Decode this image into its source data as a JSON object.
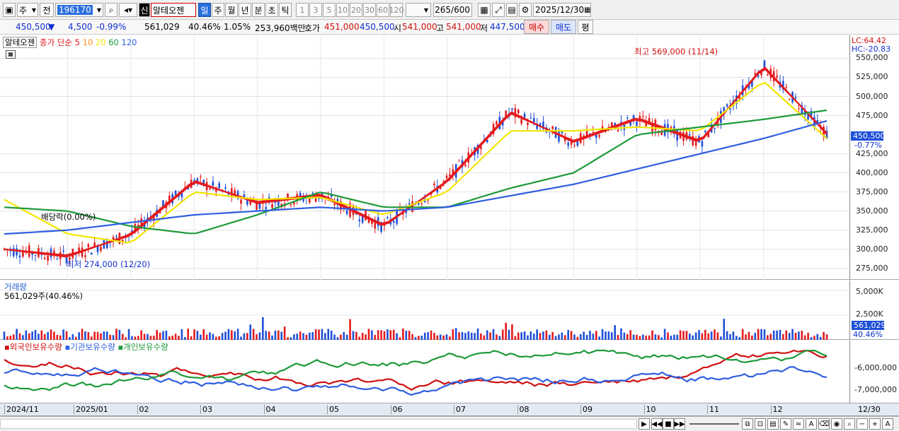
{
  "toolbar": {
    "market_label": "주",
    "market_arrow": "▼",
    "scope_label": "전",
    "code": "196170",
    "company_badge": "신",
    "company_name": "알테오젠",
    "periods": [
      "일",
      "주",
      "월",
      "년",
      "분",
      "초",
      "틱"
    ],
    "selected_period": "일",
    "intervals": [
      "1",
      "3",
      "5",
      "10",
      "20",
      "30",
      "60",
      "120"
    ],
    "count": "265",
    "count_total": "/600",
    "date": "2025/12/30"
  },
  "quote": {
    "price": "450,500",
    "change": "4,500",
    "change_arrow": "▼",
    "change_pct": "-0.99%",
    "volume": "561,029",
    "turnover_pct": "40.46%",
    "ratio": "1.05%",
    "amount": "253,960백만",
    "bid_label": "호가",
    "bid": "451,000",
    "ask": "450,500",
    "open_label": "시",
    "open": "541,000",
    "high_label": "고",
    "high": "541,000",
    "low_label": "저",
    "low": "447,500",
    "buy_label": "매수",
    "sell_label": "매도",
    "eval_label": "평"
  },
  "price_pane": {
    "title": "알테오젠",
    "legend_close": "종가",
    "legend_type": "단순",
    "ma": [
      {
        "period": "5",
        "color": "#e41a1c"
      },
      {
        "period": "10",
        "color": "#ff8c1a"
      },
      {
        "period": "20",
        "color": "#f2e600"
      },
      {
        "period": "60",
        "color": "#1f9a3a"
      },
      {
        "period": "120",
        "color": "#2f5fe0"
      }
    ],
    "lc": "LC:64.42",
    "hc": "HC:-20.83",
    "current_tag": "450,500",
    "current_pct": "-0.77%",
    "high_note": "최고 569,000 (11/14)",
    "low_note": "최저 274,000 (12/20)",
    "div_note": "배당락(0.00%)",
    "y_ticks": [
      "550,000",
      "525,000",
      "500,000",
      "475,000",
      "425,000",
      "400,000",
      "375,000",
      "350,000",
      "325,000",
      "300,000",
      "275,000"
    ]
  },
  "volume_pane": {
    "title": "거래량",
    "value": "561,029주(40.46%)",
    "y_ticks": [
      "5,000K",
      "2,500K"
    ],
    "tag": "561,029",
    "tag_pct": "40.46%"
  },
  "holding_pane": {
    "legends": [
      {
        "label": "외국인보유수량",
        "color": "#d01010"
      },
      {
        "label": "기관보유수량",
        "color": "#2f5fe0"
      },
      {
        "label": "개인보유수량",
        "color": "#1f9a3a"
      }
    ],
    "y_ticks": [
      "-6,000,000",
      "-7,000,000"
    ]
  },
  "x_axis": {
    "labels": [
      "2024/11",
      "2025/01",
      "02",
      "03",
      "04",
      "05",
      "06",
      "07",
      "08",
      "09",
      "10",
      "11",
      "12"
    ],
    "end_label": "12/30"
  },
  "chart_data": {
    "type": "line",
    "title": "알테오젠",
    "x": [
      "2024/11",
      "2025/01",
      "02",
      "03",
      "04",
      "05",
      "06",
      "07",
      "08",
      "09",
      "10",
      "11",
      "12",
      "12/30"
    ],
    "series": [
      {
        "name": "종가",
        "values": [
          300000,
          290000,
          320000,
          390000,
          360000,
          370000,
          330000,
          390000,
          480000,
          440000,
          470000,
          440000,
          540000,
          450500
        ]
      },
      {
        "name": "5",
        "values": [
          300000,
          292000,
          318000,
          388000,
          362000,
          372000,
          332000,
          388000,
          478000,
          442000,
          472000,
          442000,
          538000,
          452000
        ]
      },
      {
        "name": "20",
        "values": [
          365000,
          320000,
          308000,
          375000,
          365000,
          368000,
          345000,
          375000,
          455000,
          455000,
          460000,
          455000,
          520000,
          445000
        ]
      },
      {
        "name": "60",
        "values": [
          355000,
          350000,
          330000,
          320000,
          345000,
          375000,
          355000,
          355000,
          380000,
          400000,
          450000,
          460000,
          470000,
          482000
        ]
      },
      {
        "name": "120",
        "values": [
          320000,
          325000,
          335000,
          345000,
          350000,
          355000,
          350000,
          355000,
          370000,
          385000,
          405000,
          425000,
          445000,
          468000
        ]
      }
    ],
    "ylim": [
      260000,
      580000
    ],
    "volume_series": {
      "name": "거래량",
      "ylim": [
        0,
        6000000
      ],
      "last": 561029
    },
    "holding_series": [
      {
        "name": "외국인보유수량"
      },
      {
        "name": "기관보유수량"
      },
      {
        "name": "개인보유수량"
      }
    ]
  }
}
